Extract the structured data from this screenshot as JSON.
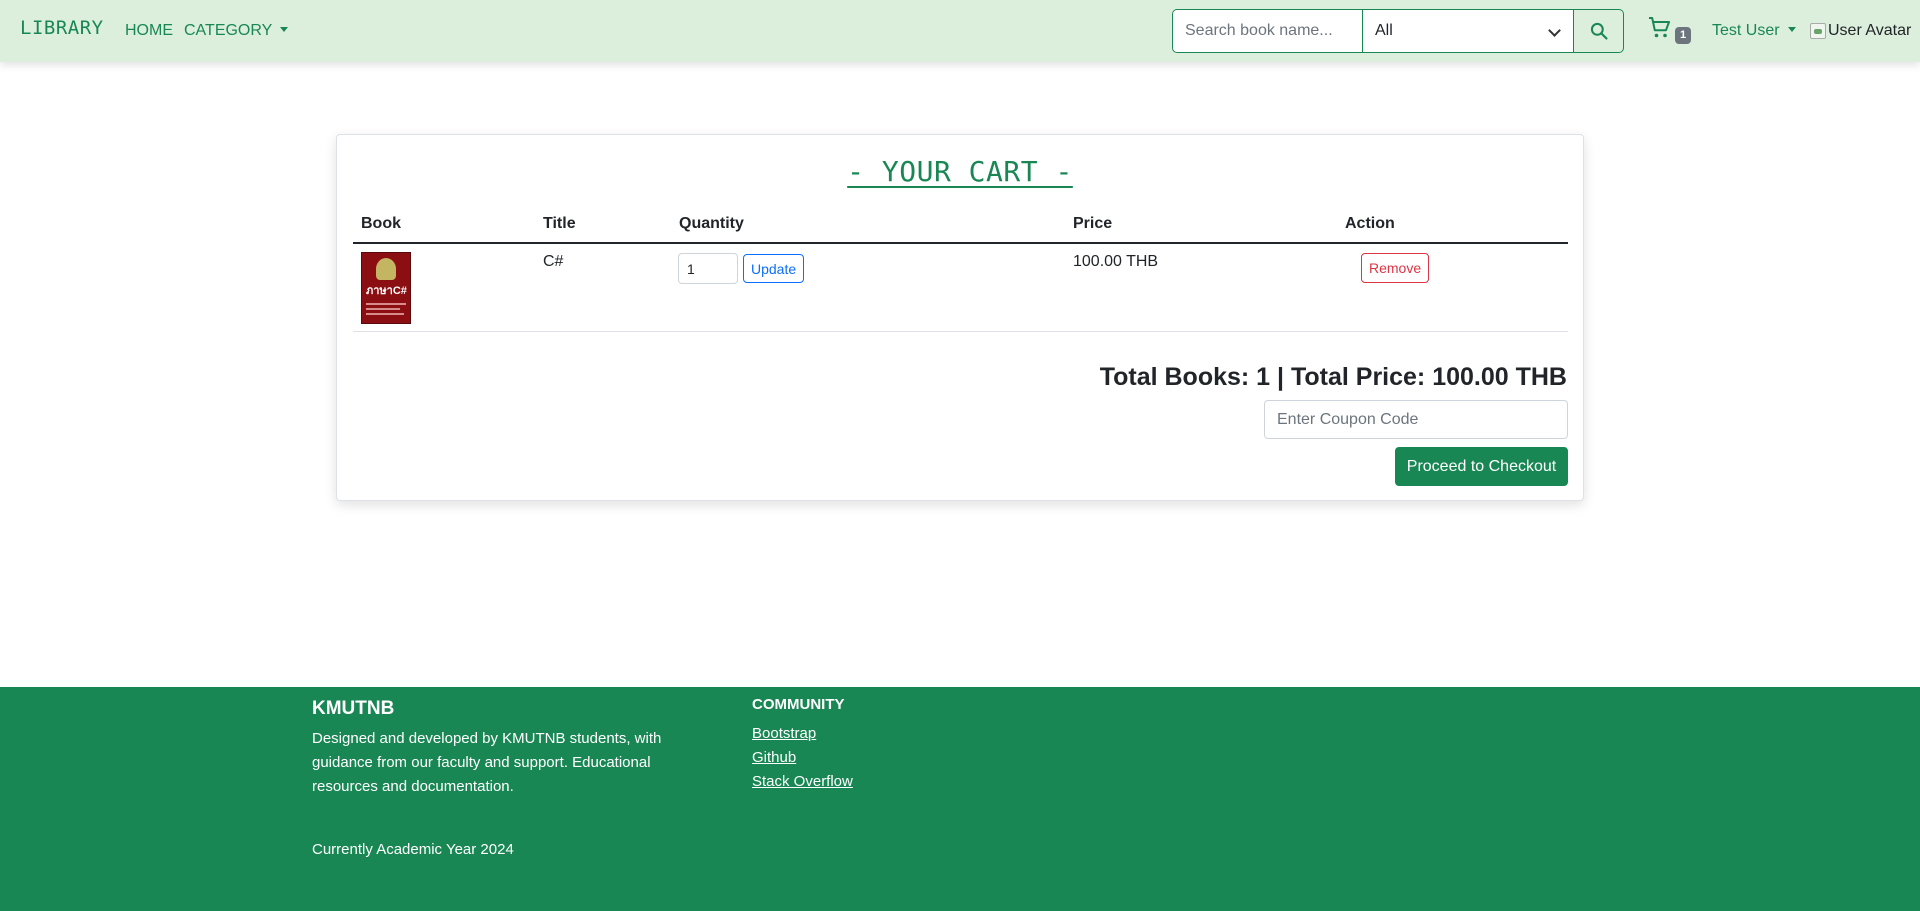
{
  "navbar": {
    "brand": "LIBRARY",
    "home": "HOME",
    "category": "CATEGORY",
    "search": {
      "placeholder": "Search book name...",
      "value": ""
    },
    "filter": {
      "selected": "All"
    },
    "cart_count": "1",
    "user_name": "Test User",
    "avatar_alt": "User Avatar"
  },
  "cart": {
    "title": "- YOUR CART -",
    "headers": {
      "book": "Book",
      "title": "Title",
      "quantity": "Quantity",
      "price": "Price",
      "action": "Action"
    },
    "items": [
      {
        "cover_text": "ภาษาC#",
        "title": "C#",
        "quantity": "1",
        "update_label": "Update",
        "price": "100.00 THB",
        "remove_label": "Remove"
      }
    ],
    "summary": "Total Books: 1 | Total Price: 100.00 THB",
    "coupon_placeholder": "Enter Coupon Code",
    "checkout_label": "Proceed to Checkout"
  },
  "footer": {
    "brand": "KMUTNB",
    "description": "Designed and developed by KMUTNB students, with guidance from our faculty and support. Educational resources and documentation.",
    "academic_year": "Currently Academic Year 2024",
    "community_heading": "COMMUNITY",
    "links": [
      "Bootstrap",
      "Github",
      "Stack Overflow"
    ]
  },
  "colors": {
    "primary": "#198754",
    "navbar_bg": "#dcefdc",
    "update_blue": "#0d6efd",
    "remove_red": "#dc3545",
    "badge_gray": "#6c757d"
  },
  "icons": {
    "search": "search-icon",
    "cart": "cart-icon",
    "dropdown": "caret-down-icon"
  }
}
